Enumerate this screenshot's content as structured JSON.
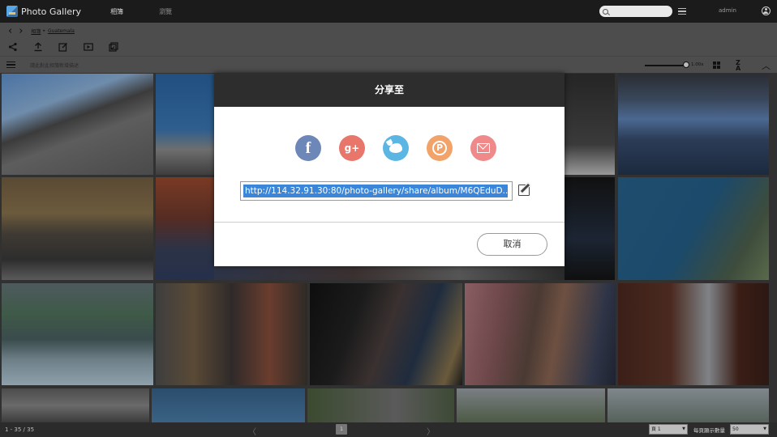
{
  "app": {
    "title": "Photo Gallery"
  },
  "nav": {
    "tab_albums": "相簿",
    "tab_browse": "瀏覽"
  },
  "search": {
    "placeholder": ""
  },
  "user": {
    "name": "admin"
  },
  "breadcrumb": {
    "root": "相簿",
    "separator": "▸",
    "current": "Guatemala"
  },
  "album": {
    "description_placeholder": "請此對此相簿新增描述"
  },
  "zoom": {
    "label": "1.00x"
  },
  "share_dialog": {
    "title": "分享至",
    "services": [
      {
        "name": "facebook",
        "glyph": "f"
      },
      {
        "name": "google-plus",
        "glyph": "g+"
      },
      {
        "name": "twitter",
        "glyph": ""
      },
      {
        "name": "plurk",
        "glyph": "P"
      },
      {
        "name": "email",
        "glyph": ""
      }
    ],
    "link": "http://114.32.91.30:80/photo-gallery/share/album/M6QEduD...",
    "cancel_label": "取消"
  },
  "pagination": {
    "count": "1 - 35 / 35",
    "prev": "〈",
    "current_page": "1",
    "next": "〉",
    "page_select": "頁 1",
    "per_page_label": "每頁顯示數量",
    "per_page_value": "50"
  },
  "colors": {
    "topbar": "#1b1b1b",
    "dialog_header": "#2d2d2d",
    "selection": "#3b86d8",
    "facebook": "#6d87b8",
    "google_plus": "#e8766b",
    "twitter": "#5cb6e3",
    "plurk": "#f1a36a",
    "email": "#f08a8a"
  }
}
